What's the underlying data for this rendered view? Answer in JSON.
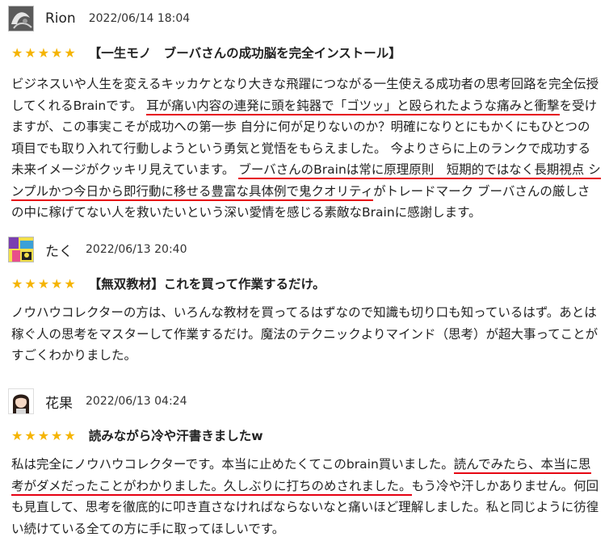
{
  "reviews": [
    {
      "name": "Rion",
      "date": "2022/06/14 18:04",
      "stars": "★★★★★",
      "rating": 5,
      "title": "【一生モノ　ブーバさんの成功脳を完全インストール】",
      "body": {
        "p1": "ビジネスいや人生を変えるキッカケとなり大きな飛躍につながる一生使える成功者の思考回路を完全伝授してくれるBrainです。",
        "u1": "耳が痛い内容の連発に頭を鈍器で「ゴツッ」と殴られたような痛みと衝撃",
        "p2": "を受けますが、この事実こそが成功への第一歩 自分に何が足りないのか？明確になりとにもかくにもひとつの項目でも取り入れて行動しようという勇気と覚悟をもらえました。 今よりさらに上のランクで成功する未来イメージがクッキリ見えています。",
        "u2": "ブーバさんのBrainは常に原理原則　短期的ではなく長期視点 シンプルかつ今日から即行動に移せる豊富な具体例で鬼クオリティ",
        "p3": "がトレードマーク ブーバさんの厳しさの中に稼げてない人を救いたいという深い愛情を感じる素敵なBrainに感謝します。"
      }
    },
    {
      "name": "たく",
      "date": "2022/06/13 20:40",
      "stars": "★★★★★",
      "rating": 5,
      "title": "【無双教材】これを買って作業するだけ。",
      "body": {
        "p1": "ノウハウコレクターの方は、いろんな教材を買ってるはずなので知識も切り口も知っているはず。あとは稼ぐ人の思考をマスターして作業するだけ。魔法のテクニックよりマインド（思考）が超大事ってことがすごくわかりました。"
      }
    },
    {
      "name": "花果",
      "date": "2022/06/13 04:24",
      "stars": "★★★★★",
      "rating": 5,
      "title": "読みながら冷や汗書きましたw",
      "body": {
        "p1": "私は完全にノウハウコレクターです。本当に止めたくてこのbrain買いました。",
        "u1": "読んでみたら、本当に思考がダメだったことがわかりました。久しぶりに打ちのめされました。",
        "p2": "もう冷や汗しかありません。何回も見直して、思考を徹底的に叩き直さなければならないなと痛いほど理解しました。私と同じように彷徨い続けている全ての方に手に取ってほしいです。"
      }
    }
  ],
  "colors": {
    "star": "#f5b400",
    "underline": "#e60012",
    "text": "#222222"
  },
  "icons": {
    "avatar1": "avatar-icon-mono-swirl",
    "avatar2": "avatar-icon-colorful-manga",
    "avatar3": "avatar-icon-girl-portrait"
  }
}
